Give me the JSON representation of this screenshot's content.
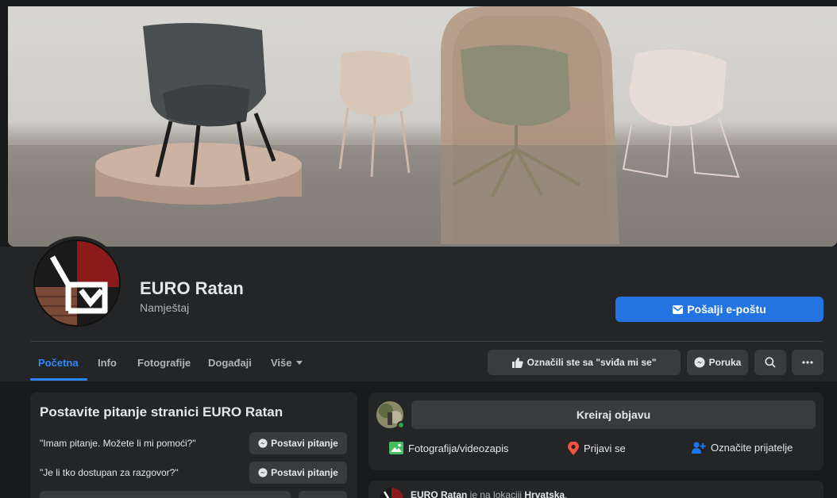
{
  "page": {
    "name": "EURO Ratan",
    "category": "Namještaj"
  },
  "header": {
    "email_button": "Pošalji e-poštu"
  },
  "tabs": [
    {
      "label": "Početna",
      "active": true
    },
    {
      "label": "Info"
    },
    {
      "label": "Fotografije"
    },
    {
      "label": "Događaji"
    },
    {
      "label": "Više"
    }
  ],
  "actions": {
    "liked_label": "Označili ste sa \"sviđa mi se\"",
    "message_label": "Poruka"
  },
  "ask_card": {
    "title": "Postavite pitanje stranici EURO Ratan",
    "questions": [
      {
        "text": "\"Imam pitanje. Možete li mi pomoći?\"",
        "button": "Postavi pitanje"
      },
      {
        "text": "\"Je li tko dostupan za razgovor?\"",
        "button": "Postavi pitanje"
      }
    ]
  },
  "composer": {
    "create_post": "Kreiraj objavu",
    "photo_video": "Fotografija/videozapis",
    "check_in": "Prijavi se",
    "tag_friends": "Označite prijatelje"
  },
  "post": {
    "author": "EURO Ratan",
    "middle": " je na lokaciji ",
    "location": "Hrvatska",
    "end": "."
  },
  "colors": {
    "accent": "#2374e1",
    "tab_active": "#2d88ff",
    "card_bg": "#242526",
    "page_bg": "#18191a",
    "button_bg": "#3a3b3c"
  },
  "icons": {
    "email": "envelope-icon",
    "like": "thumbs-up-icon",
    "message": "messenger-icon",
    "search": "search-icon",
    "more": "more-icon",
    "photo": "photo-icon",
    "check_in": "location-pin-icon",
    "tag": "tag-friends-icon"
  }
}
